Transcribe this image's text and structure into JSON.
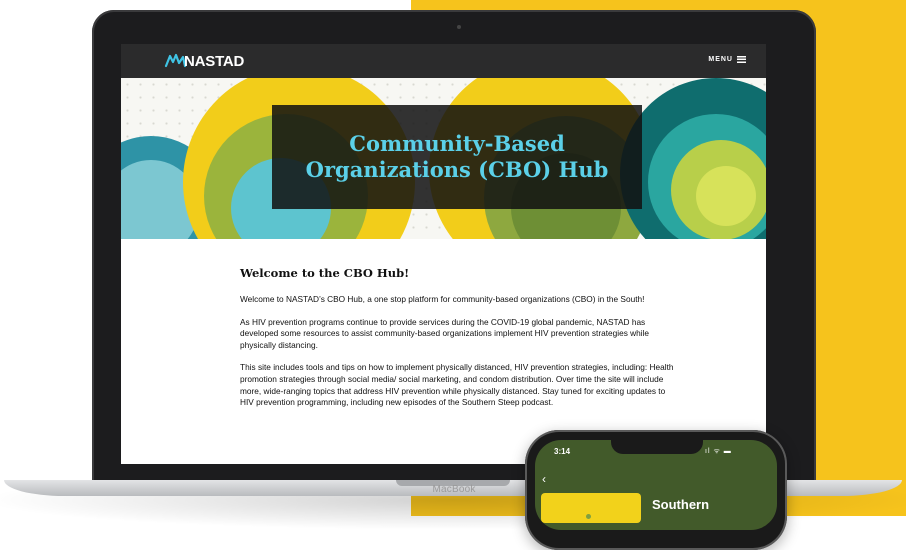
{
  "site": {
    "logo_text": "NASTAD",
    "menu_label": "MENU",
    "hero_title": "Community-Based Organizations (CBO) Hub",
    "welcome_heading": "Welcome to the CBO Hub!",
    "paragraphs": [
      "Welcome to NASTAD’s CBO Hub, a one stop platform for community-based organizations (CBO) in the South!",
      "As HIV prevention programs continue to provide services during the COVID-19 global pandemic, NASTAD has developed some resources to assist community-based organizations implement HIV prevention strategies while physically distancing.",
      "This site includes tools and tips on how to implement physically distanced, HIV prevention strategies, including: Health promotion strategies through social media/ social marketing, and condom distribution. Over time the site will include more, wide-ranging topics that address HIV prevention while physically distanced. Stay tuned for exciting updates to HIV prevention programming, including new episodes of the Southern Steep podcast."
    ]
  },
  "device": {
    "laptop_label": "MacBook"
  },
  "phone": {
    "time": "3:14",
    "status_icons": "ıl ᯤ ▬",
    "back_icon": "‹",
    "podcast_title": "Southern"
  },
  "colors": {
    "yellow": "#f6c31c",
    "nav_dark": "#2b2b2c",
    "hero_title": "#5bd0e8",
    "teal": "#2e93a6",
    "olive": "#8ea83f",
    "dark_teal": "#0f6d6e",
    "lime": "#d7e25a"
  },
  "icons": {
    "logo": "nastad-logo-mark",
    "menu": "hamburger-icon",
    "back": "chevron-left-icon"
  }
}
